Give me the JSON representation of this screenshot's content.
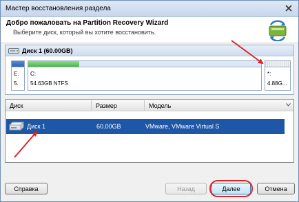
{
  "window": {
    "title": "Мастер восстановления раздела",
    "close_icon": "close-icon"
  },
  "header": {
    "title": "Добро пожаловать на Partition Recovery Wizard",
    "subtitle": "Выберите диск, который вы хотите восстановить.",
    "logo_icon": "recovery-wizard-icon"
  },
  "disk_map": {
    "disk_label": "Диск 1 (60.00GB)",
    "disk_icon": "disk-icon",
    "partitions": [
      {
        "line1": "E.",
        "line2": "5.",
        "bar_color": "#3a6fc4"
      },
      {
        "line1": "C:",
        "line2": "54.63GB NTFS",
        "used_fraction": 0.22,
        "bar_color": "#5cc058"
      },
      {
        "line1": "*:",
        "line2": "4.88G...",
        "bar_color": "#e0e0e0"
      }
    ]
  },
  "table": {
    "columns": [
      "Диск",
      "Размер",
      "Модель"
    ],
    "rows": [
      {
        "disk": "Диск 1",
        "size": "60.00GB",
        "model": "VMware, VMware Virtual S",
        "selected": true
      }
    ]
  },
  "buttons": {
    "help": "Справка",
    "back": "Назад",
    "next": "Далее",
    "cancel": "Отмена"
  },
  "colors": {
    "selection": "#1d57a5",
    "annotation": "#d9262a"
  }
}
